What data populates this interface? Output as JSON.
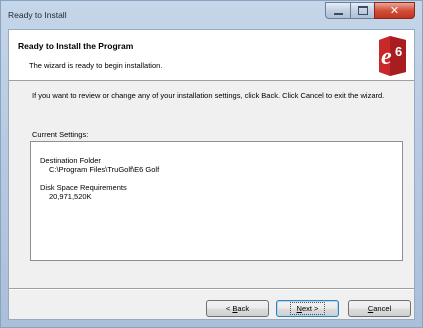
{
  "window": {
    "title": "Ready to Install"
  },
  "header": {
    "title": "Ready to Install the Program",
    "subtitle": "The wizard is ready to begin installation.",
    "logo_text": "E6"
  },
  "body": {
    "intro": "If you want to review or change any of your installation settings, click Back. Click Cancel to exit the wizard.",
    "current_settings_label": "Current Settings:",
    "settings": {
      "destination_label": "Destination Folder",
      "destination_value": "C:\\Program Files\\TruGolf\\E6 Golf",
      "disk_label": "Disk Space Requirements",
      "disk_value": "20,971,520K"
    }
  },
  "buttons": {
    "back": {
      "prefix": "< ",
      "accel": "B",
      "rest": "ack"
    },
    "next": {
      "accel": "N",
      "rest": "ext >"
    },
    "cancel": {
      "accel": "C",
      "rest": "ancel"
    }
  },
  "colors": {
    "logo_red": "#c8282a",
    "title_blue": "#1b2838"
  }
}
